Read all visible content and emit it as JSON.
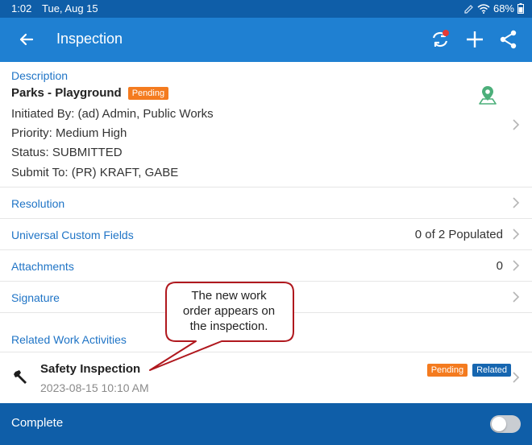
{
  "status_bar": {
    "time": "1:02",
    "date": "Tue, Aug 15",
    "battery": "68%"
  },
  "app_bar": {
    "title": "Inspection",
    "icons": [
      "back-arrow-icon",
      "sync-icon",
      "add-icon",
      "share-icon"
    ],
    "sync_alert_color": "#e53935"
  },
  "description": {
    "section_label": "Description",
    "title": "Parks - Playground",
    "status_badge": "Pending",
    "initiated_by": "Initiated By: (ad) Admin, Public Works",
    "priority": "Priority: Medium High",
    "status": "Status: SUBMITTED",
    "submit_to": "Submit To: (PR) KRAFT, GABE",
    "map_icon": "map-pin-icon"
  },
  "rows": [
    {
      "label": "Resolution",
      "value": ""
    },
    {
      "label": "Universal Custom Fields",
      "value": "0 of 2 Populated"
    },
    {
      "label": "Attachments",
      "value": "0"
    },
    {
      "label": "Signature",
      "value": ""
    }
  ],
  "related": {
    "header": "Related Work Activities",
    "items": [
      {
        "name": "Safety Inspection",
        "datetime": "2023-08-15 10:10 AM",
        "badges": [
          "Pending",
          "Related"
        ],
        "icon": "wrench-icon"
      }
    ]
  },
  "bottom_bar": {
    "label": "Complete",
    "toggle_on": false
  },
  "callout": {
    "line1": "The new work",
    "line2": "order appears on",
    "line3": "the inspection."
  },
  "colors": {
    "status_bar": "#0f5ea8",
    "app_bar": "#1f80d2",
    "link_blue": "#1f74c6",
    "pending_badge": "#f47b1f",
    "related_badge": "#1666b0",
    "callout_border": "#b0181e",
    "pin_green": "#4caf7a"
  }
}
